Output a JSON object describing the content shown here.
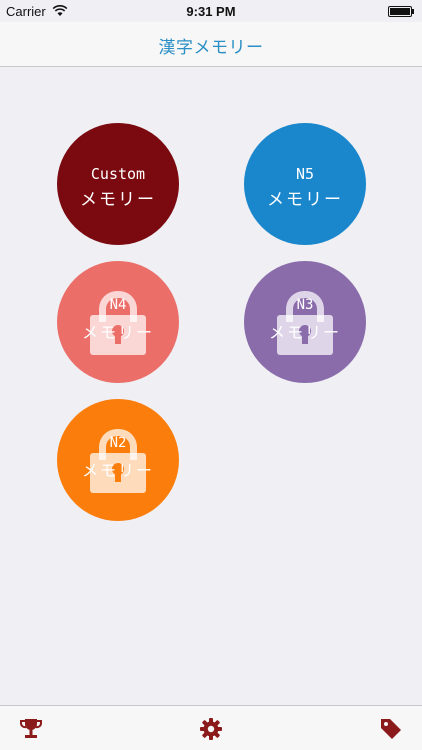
{
  "status": {
    "carrier": "Carrier",
    "time": "9:31 PM"
  },
  "nav": {
    "title": "漢字メモリー"
  },
  "decks": [
    {
      "line1": "Custom",
      "line2": "メモリー",
      "color": "#7a0a10",
      "locked": false
    },
    {
      "line1": "N5",
      "line2": "メモリー",
      "color": "#1a86cb",
      "locked": false
    },
    {
      "line1": "N4",
      "line2": "メモリー",
      "color": "#ec6e69",
      "locked": true
    },
    {
      "line1": "N3",
      "line2": "メモリー",
      "color": "#8a6cab",
      "locked": true
    },
    {
      "line1": "N2",
      "line2": "メモリー",
      "color": "#fb7d0c",
      "locked": true
    }
  ],
  "tabbar": {
    "accent": "#8b1a1a",
    "icons": [
      "trophy-icon",
      "gear-icon",
      "tag-icon"
    ]
  }
}
